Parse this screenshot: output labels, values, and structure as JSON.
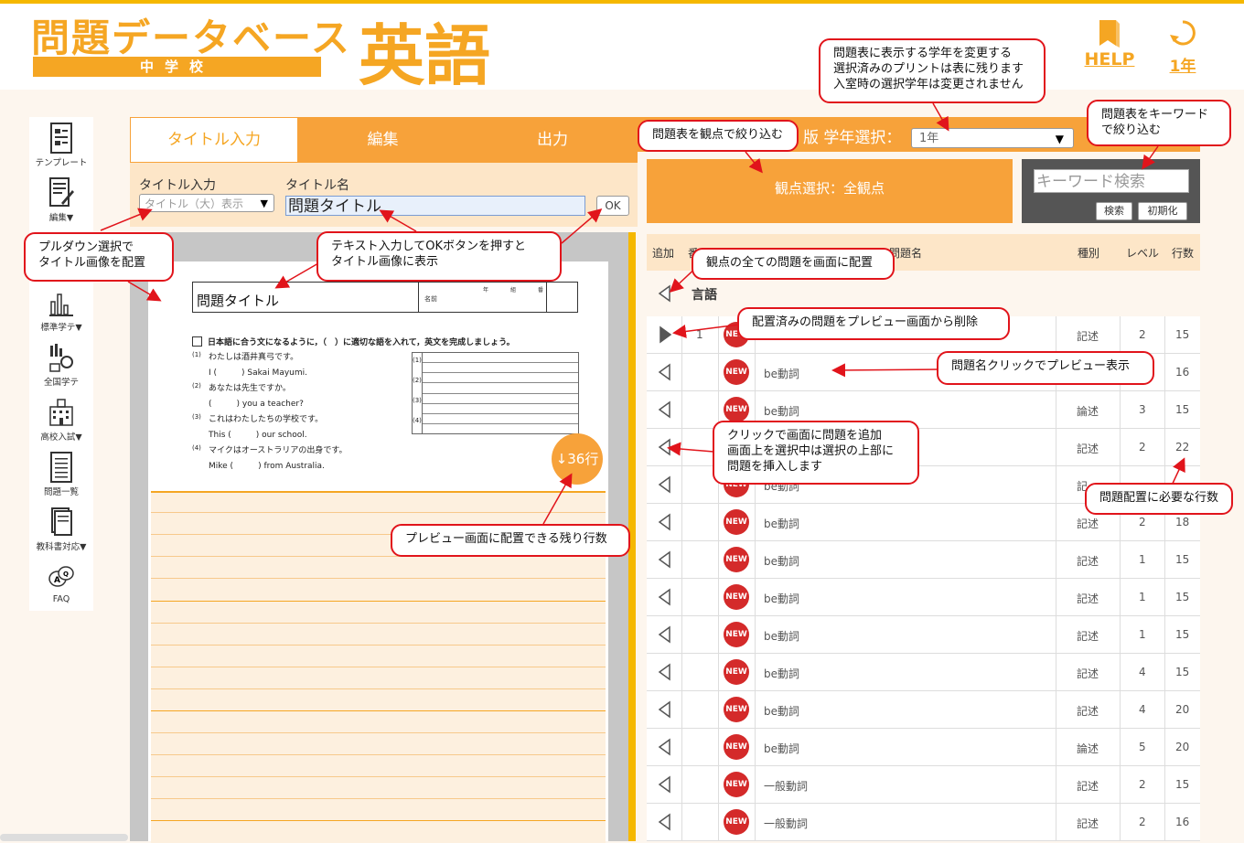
{
  "header": {
    "logo_title": "問題データベース",
    "logo_sub": "中学校",
    "subject": "英語",
    "help_label": "HELP",
    "grade_label": "1年"
  },
  "sidebar": {
    "items": [
      {
        "label": "テンプレート",
        "icon": "template-icon"
      },
      {
        "label": "編集▼",
        "icon": "edit-icon"
      },
      {
        "label": "標準学テ▼",
        "icon": "chart-icon"
      },
      {
        "label": "全国学テ",
        "icon": "national-test-icon"
      },
      {
        "label": "高校入試▼",
        "icon": "school-icon"
      },
      {
        "label": "問題一覧",
        "icon": "list-icon"
      },
      {
        "label": "教科書対応▼",
        "icon": "textbook-icon"
      },
      {
        "label": "FAQ",
        "icon": "faq-icon"
      }
    ]
  },
  "tabs": [
    "タイトル入力",
    "編集",
    "出力"
  ],
  "title_area": {
    "input_label": "タイトル入力",
    "name_label": "タイトル名",
    "select_value": "タイトル（大）表示",
    "title_value": "問題タイトル",
    "ok_label": "OK"
  },
  "paper": {
    "title": "問題タイトル",
    "name_label": "名前",
    "meta": "年組番",
    "instruction": "日本語に合う文になるように，（　）に適切な語を入れて，英文を完成しましょう。",
    "questions": [
      {
        "num": "(1)",
        "jp": "わたしは酒井真弓です。",
        "en": "I (　　　) Sakai Mayumi."
      },
      {
        "num": "(2)",
        "jp": "あなたは先生ですか。",
        "en": "(　　　) you a teacher?"
      },
      {
        "num": "(3)",
        "jp": "これはわたしたちの学校です。",
        "en": "This (　　　) our school."
      },
      {
        "num": "(4)",
        "jp": "マイクはオーストラリアの出身です。",
        "en": "Mike (　　　) from Australia."
      }
    ],
    "answer_nums": [
      "(1)",
      "(2)",
      "(3)",
      "(4)"
    ],
    "remaining_lines": "↓36行"
  },
  "right": {
    "grade_select_label": "版 学年選択：",
    "grade_select_value": "1年",
    "viewpoint_button": "観点選択：全観点",
    "keyword_placeholder": "キーワード検索",
    "search_button": "検索",
    "reset_button": "初期化",
    "columns": {
      "add": "追加",
      "num": "番",
      "name": "問題名",
      "type": "種別",
      "level": "レベル",
      "lines": "行数"
    },
    "section_title": "言語",
    "rows": [
      {
        "placed": true,
        "num": "1",
        "badge": "NEW",
        "name": "",
        "type": "記述",
        "level": "2",
        "lines": "15"
      },
      {
        "placed": false,
        "num": "",
        "badge": "NEW",
        "name": "be動詞",
        "type": "",
        "level": "",
        "lines": "16"
      },
      {
        "placed": false,
        "num": "",
        "badge": "NEW",
        "name": "be動詞",
        "type": "論述",
        "level": "3",
        "lines": "15"
      },
      {
        "placed": false,
        "num": "",
        "badge": "NEW",
        "name": "",
        "type": "記述",
        "level": "2",
        "lines": "22"
      },
      {
        "placed": false,
        "num": "",
        "badge": "NEW",
        "name": "be動詞",
        "type": "記",
        "level": "",
        "lines": ""
      },
      {
        "placed": false,
        "num": "",
        "badge": "NEW",
        "name": "be動詞",
        "type": "記述",
        "level": "2",
        "lines": "18"
      },
      {
        "placed": false,
        "num": "",
        "badge": "NEW",
        "name": "be動詞",
        "type": "記述",
        "level": "1",
        "lines": "15"
      },
      {
        "placed": false,
        "num": "",
        "badge": "NEW",
        "name": "be動詞",
        "type": "記述",
        "level": "1",
        "lines": "15"
      },
      {
        "placed": false,
        "num": "",
        "badge": "NEW",
        "name": "be動詞",
        "type": "記述",
        "level": "1",
        "lines": "15"
      },
      {
        "placed": false,
        "num": "",
        "badge": "NEW",
        "name": "be動詞",
        "type": "記述",
        "level": "4",
        "lines": "15"
      },
      {
        "placed": false,
        "num": "",
        "badge": "NEW",
        "name": "be動詞",
        "type": "記述",
        "level": "4",
        "lines": "20"
      },
      {
        "placed": false,
        "num": "",
        "badge": "NEW",
        "name": "be動詞",
        "type": "論述",
        "level": "5",
        "lines": "20"
      },
      {
        "placed": false,
        "num": "",
        "badge": "NEW",
        "name": "一般動詞",
        "type": "記述",
        "level": "2",
        "lines": "15"
      },
      {
        "placed": false,
        "num": "",
        "badge": "NEW",
        "name": "一般動詞",
        "type": "記述",
        "level": "2",
        "lines": "16"
      }
    ]
  },
  "callouts": {
    "grade_change": "問題表に表示する学年を変更する\n選択済みのプリントは表に残ります\n入室時の選択学年は変更されません",
    "keyword_filter": "問題表をキーワード\nで絞り込む",
    "viewpoint_filter": "問題表を観点で絞り込む",
    "pulldown": "プルダウン選択で\nタイトル画像を配置",
    "text_input": "テキスト入力してOKボタンを押すと\nタイトル画像に表示",
    "place_all": "観点の全ての問題を画面に配置",
    "remove": "配置済みの問題をプレビュー画面から削除",
    "preview": "問題名クリックでプレビュー表示",
    "add_problem": "クリックで画面に問題を追加\n画面上を選択中は選択の上部に\n問題を挿入します",
    "lines_needed": "問題配置に必要な行数",
    "remaining": "プレビュー画面に配置できる残り行数"
  },
  "colors": {
    "accent": "#f7a23a",
    "brand": "#f5a623",
    "callout_border": "#e1141b",
    "new_badge": "#d42a2a"
  }
}
